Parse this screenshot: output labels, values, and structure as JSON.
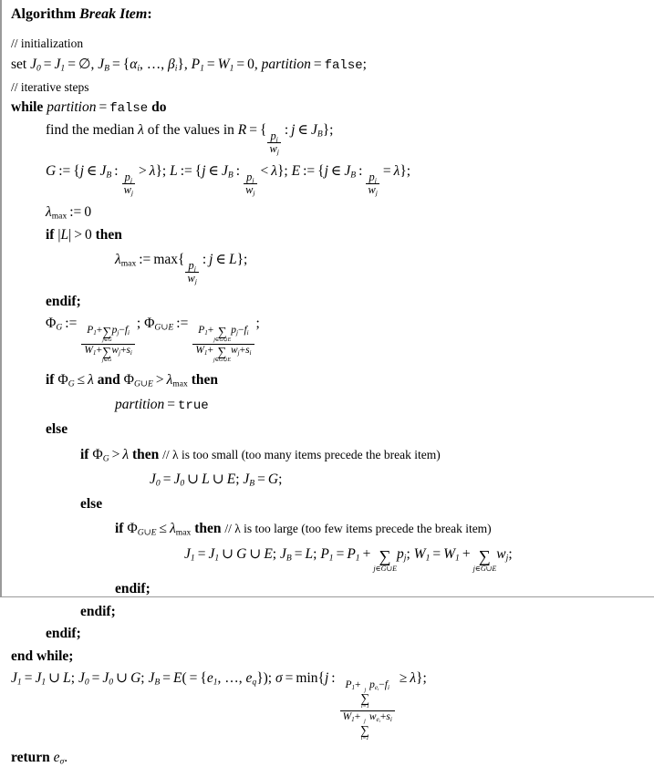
{
  "document": {
    "type": "algorithm-pseudocode",
    "title_keyword": "Algorithm",
    "title_name": "Break Item",
    "title_colon": ":"
  },
  "lines": {
    "comment_init": "// initialization",
    "comment_iter": "// iterative steps",
    "set_kw": "set",
    "while_kw": "while",
    "do_kw": "do",
    "find_median_text": "find the median",
    "of_values_text": "of the values in",
    "if_kw": "if",
    "then_kw": "then",
    "else_kw": "else",
    "and_kw": "and",
    "endif_kw": "endif;",
    "end_while_kw": "end while;",
    "return_kw": "return",
    "max_op": "max",
    "min_op": "min",
    "true_val": "true",
    "false_val": "false",
    "partition_var": "partition",
    "comment_too_small": "// λ is too small (too many items precede the break item)",
    "comment_too_large": "// λ is too large (too few items precede the break item)"
  },
  "symbols": {
    "lambda": "λ",
    "lambda_max_sub": "max",
    "alpha": "α",
    "beta": "β",
    "sigma": "σ",
    "phi": "Φ",
    "emptyset": "∅",
    "union": "∪",
    "elem": "∈",
    "leq": "≤",
    "geq": "≥",
    "gt": ">",
    "lt": "<",
    "eq": "=",
    "assign": ":=",
    "sum": "∑",
    "ldots": "…"
  },
  "variables": {
    "J0": "J",
    "J0_sub": "0",
    "J1": "J",
    "J1_sub": "1",
    "JB": "J",
    "JB_sub": "B",
    "P1": "P",
    "P1_sub": "1",
    "W1": "W",
    "W1_sub": "1",
    "R": "R",
    "G": "G",
    "L": "L",
    "E": "E",
    "p": "p",
    "w": "w",
    "j": "j",
    "i": "i",
    "f": "f",
    "s": "s",
    "e": "e",
    "q": "q",
    "one": "1",
    "zero": "0"
  },
  "colors": {
    "text": "#000000",
    "background": "#ffffff",
    "border": "#9a9a9a"
  }
}
